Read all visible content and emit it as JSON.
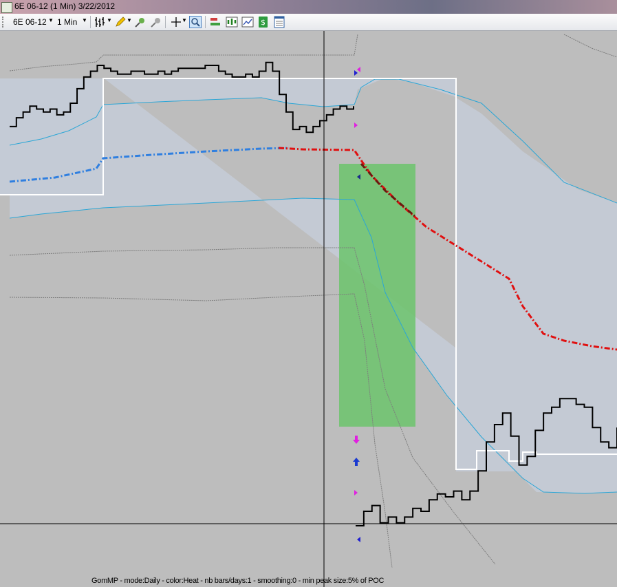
{
  "window": {
    "title": "6E 06-12 (1 Min)  3/22/2012"
  },
  "toolbar": {
    "instrument": "6E 06-12",
    "interval": "1 Min",
    "icons": [
      "bar-type-icon",
      "drawing-pencil-icon",
      "zoom-in-icon",
      "zoom-out-icon",
      "crosshair-icon",
      "magnifier-icon",
      "strategies-icon",
      "indicators-icon",
      "chart-properties-icon",
      "order-dollar-icon",
      "data-box-icon"
    ]
  },
  "colors": {
    "background": "#bdbdbd",
    "price": "#000000",
    "band_inner": "#2aa6d6",
    "band_outer": "#7d7d7d",
    "vwap_day1": "#2f7fe0",
    "vwap_day2": "#e01010",
    "value_area": "#ffffff",
    "green_zone": "#6cc46c",
    "shade": "#c4cbd6"
  },
  "chart_data": {
    "type": "line",
    "title": "",
    "footer": "GomMP - mode:Daily  - color:Heat - nb bars/days:1 - smoothing:0 - min peak size:5% of POC",
    "series": [
      {
        "values": [
          31,
          34,
          36,
          38,
          37,
          36,
          37,
          35,
          36,
          39,
          44,
          48,
          50,
          52,
          51,
          50,
          49,
          49,
          50,
          50,
          49,
          49,
          50,
          49,
          50,
          51,
          51,
          51,
          51,
          52,
          52,
          50,
          49,
          48,
          48,
          49,
          48,
          50,
          53,
          50,
          42,
          36,
          30,
          31,
          29,
          31,
          33,
          35,
          37,
          38,
          37,
          38
        ]
      },
      {
        "values": [
          5,
          10,
          12,
          6,
          8,
          6,
          8,
          11,
          10,
          14,
          16,
          15,
          17,
          14,
          17,
          24,
          34,
          40,
          44,
          36,
          26,
          29,
          38,
          44,
          46,
          49,
          49,
          47,
          46,
          39,
          34,
          32,
          39
        ]
      }
    ],
    "markers": {
      "magenta_triangles": 3,
      "blue_triangles": 3,
      "pink_arrow": "down",
      "blue_arrow": "up"
    }
  }
}
